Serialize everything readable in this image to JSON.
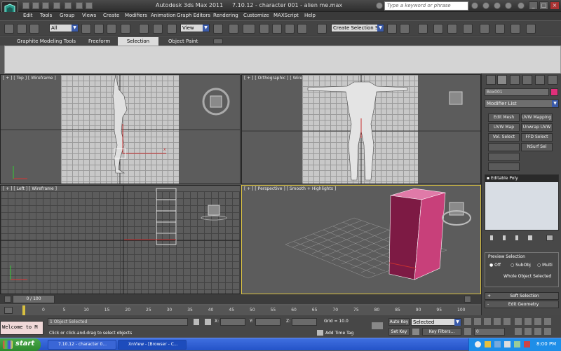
{
  "title": {
    "app": "Autodesk 3ds Max  2011",
    "version": "7.10.12 - character 001 - alien me.max"
  },
  "search": {
    "placeholder": "Type a keyword or phrase"
  },
  "menu": [
    "Edit",
    "Tools",
    "Group",
    "Views",
    "Create",
    "Modifiers",
    "Animation",
    "Graph Editors",
    "Rendering",
    "Customize",
    "MAXScript",
    "Help"
  ],
  "toolbar": {
    "filter": "All",
    "refcoord": "View",
    "selset": "Create Selection Se"
  },
  "ribbon": {
    "tabs": [
      "Graphite Modeling Tools",
      "Freeform",
      "Selection",
      "Object Paint"
    ],
    "active": "Selection"
  },
  "viewports": {
    "top": "[ + ] [ Top ] [ Wireframe ]",
    "ortho": "[ + ] [ Orthographic ] [ Wireframe ]",
    "left": "[ + ] [ Left ] [ Wireframe ]",
    "perspective": "[ + ] [ Perspective ] [ Smooth + Highlights ]"
  },
  "command_panel": {
    "object_name": "Box001",
    "modifier_list": "Modifier List",
    "buttons": [
      "Edit Mesh",
      "UVW Mapping Ad",
      "UVW Map",
      "Unwrap UVW",
      "Vol. Select",
      "FFD Select",
      "",
      "NSurf Sel"
    ],
    "stack_item": "Editable Poly",
    "preview": {
      "title": "Preview Selection",
      "options": [
        "Off",
        "SubObj",
        "Multi"
      ],
      "status": "Whole Object Selected"
    },
    "rollouts": [
      "Soft Selection",
      "Edit Geometry"
    ],
    "accent": "#e0307a"
  },
  "timeline": {
    "counter": "0 / 100",
    "ticks": [
      "0",
      "5",
      "10",
      "15",
      "20",
      "25",
      "30",
      "35",
      "40",
      "45",
      "50",
      "55",
      "60",
      "65",
      "70",
      "75",
      "80",
      "85",
      "90",
      "95",
      "100"
    ]
  },
  "status": {
    "maxscript": "Welcome to M",
    "selected": "1 Object Selected",
    "prompt": "Click or click-and-drag to select objects",
    "x_label": "X:",
    "y_label": "Y:",
    "z_label": "Z:",
    "grid": "Grid = 10.0",
    "add_time_tag": "Add Time Tag",
    "auto_key": "Auto Key",
    "set_key": "Set Key",
    "set_key_mode": "Selected",
    "key_filters": "Key Filters...",
    "frame": "0"
  },
  "taskbar": {
    "start": "start",
    "tasks": [
      "7.10.12 - character 0...",
      "XnView - [Browser - C..."
    ],
    "clock": "8:00 PM"
  }
}
